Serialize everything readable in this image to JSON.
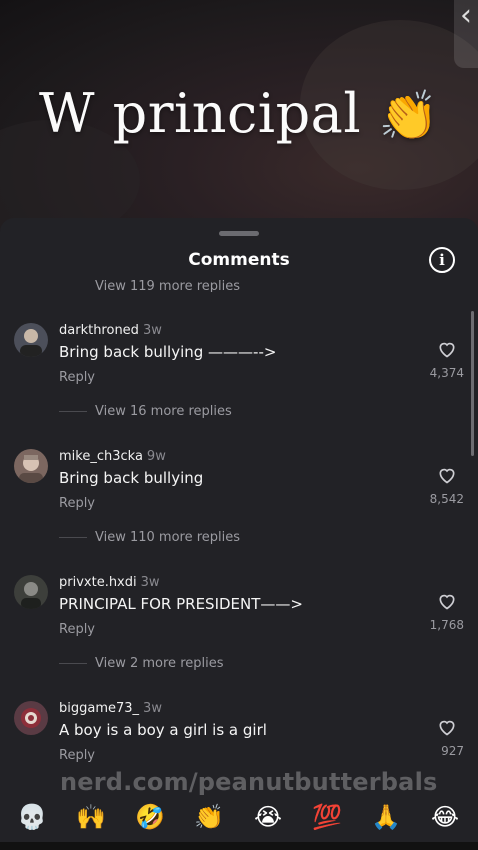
{
  "video": {
    "title": "W principal",
    "title_emoji": "👏",
    "back_icon": "chevron-left-icon"
  },
  "sheet": {
    "title": "Comments",
    "info_icon": "i",
    "clipped_replies": "View 119 more replies"
  },
  "comments": [
    {
      "username": "darkthroned",
      "time": "3w",
      "text": "Bring back bullying ———-->",
      "reply_label": "Reply",
      "more_replies": "View 16 more replies",
      "likes": "4,374",
      "avatar_color": "#4c4f5a"
    },
    {
      "username": "mike_ch3cka",
      "time": "9w",
      "text": "Bring back bullying",
      "reply_label": "Reply",
      "more_replies": "View 110 more replies",
      "likes": "8,542",
      "avatar_color": "#7c6760"
    },
    {
      "username": "privxte.hxdi",
      "time": "3w",
      "text": "PRINCIPAL FOR PRESIDENT——>",
      "reply_label": "Reply",
      "more_replies": "View 2 more replies",
      "likes": "1,768",
      "avatar_color": "#3d3f3b"
    },
    {
      "username": "biggame73_",
      "time": "3w",
      "text": "A boy is a boy a girl is a girl",
      "reply_label": "Reply",
      "likes": "927",
      "avatar_color": "#5a3b44"
    }
  ],
  "watermark": "nerd.com/peanutbutterbals",
  "emoji_bar": [
    "💀",
    "🙌",
    "🤣",
    "👏",
    "😭",
    "💯",
    "🙏",
    "😂"
  ],
  "colors": {
    "sheet_bg": "#222226",
    "secondary_text": "#9b9ba1"
  }
}
